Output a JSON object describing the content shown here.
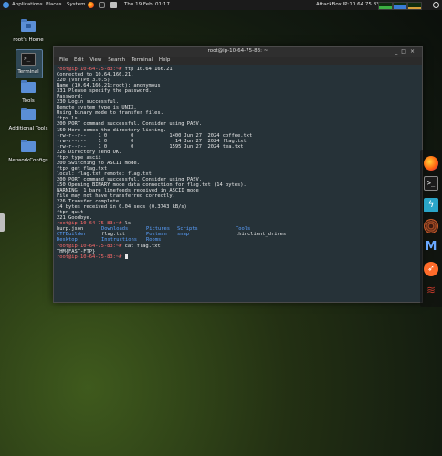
{
  "topbar": {
    "applications": "Applications",
    "places": "Places",
    "system": "System",
    "datetime": "Thu 19 Feb, 01:17",
    "ip": "AttackBox IP:10.64.75.83"
  },
  "desktop_icons": [
    {
      "label": "root's Home",
      "icon": "home-folder-icon"
    },
    {
      "label": "Terminal",
      "icon": "terminal-icon"
    },
    {
      "label": "Tools",
      "icon": "folder-icon"
    },
    {
      "label": "Additional Tools",
      "icon": "folder-icon"
    },
    {
      "label": "NetworkConfigs",
      "icon": "folder-icon"
    }
  ],
  "terminal": {
    "title": "root@ip-10-64-75-83: ~",
    "menu": [
      "File",
      "Edit",
      "View",
      "Search",
      "Terminal",
      "Help"
    ],
    "prompt": "root@ip-10-64-75-83:~#",
    "lines": [
      " ftp 10.64.166.21",
      "Connected to 10.64.166.21.",
      "220 (vsFTPd 3.0.5)",
      "Name (10.64.166.21:root): anonymous",
      "331 Please specify the password.",
      "Password:",
      "230 Login successful.",
      "Remote system type is UNIX.",
      "Using binary mode to transfer files.",
      "ftp> ls",
      "200 PORT command successful. Consider using PASV.",
      "150 Here comes the directory listing.",
      "-rw-r--r--    1 0        0            1400 Jun 27  2024 coffee.txt",
      "-rw-r--r--    1 0        0              14 Jun 27  2024 flag.txt",
      "-rw-r--r--    1 0        0            1595 Jun 27  2024 tea.txt",
      "226 Directory send OK.",
      "ftp> type ascii",
      "200 Switching to ASCII mode.",
      "ftp> get flag.txt",
      "local: flag.txt remote: flag.txt",
      "200 PORT command successful. Consider using PASV.",
      "150 Opening BINARY mode data connection for flag.txt (14 bytes).",
      "WARNING! 1 bare linefeeds received in ASCII mode",
      "File may not have transferred correctly.",
      "226 Transfer complete.",
      "14 bytes received in 0.04 secs (0.3743 kB/s)",
      "ftp> quit",
      "221 Goodbye."
    ],
    "cmd_ls": " ls",
    "ls_rows": [
      [
        {
          "text": "burp.json",
          "dir": false
        },
        {
          "text": "Downloads",
          "dir": true
        },
        {
          "text": "Pictures",
          "dir": true
        },
        {
          "text": "Scripts",
          "dir": true
        },
        {
          "text": "Tools",
          "dir": true
        }
      ],
      [
        {
          "text": "CTFBuilder",
          "dir": true
        },
        {
          "text": "flag.txt",
          "dir": false
        },
        {
          "text": "Postman",
          "dir": true
        },
        {
          "text": "snap",
          "dir": true
        },
        {
          "text": "thinclient_drives",
          "dir": false
        }
      ],
      [
        {
          "text": "Desktop",
          "dir": true
        },
        {
          "text": "Instructions",
          "dir": true
        },
        {
          "text": "Rooms",
          "dir": true
        },
        {
          "text": "",
          "dir": false
        },
        {
          "text": "",
          "dir": false
        }
      ]
    ],
    "cmd_cat": " cat flag.txt",
    "flag_output": "THM{FAST-FTP}"
  },
  "colors": {
    "prompt": "#ff6a6a",
    "directory": "#5aa0ff",
    "terminal_bg": "#263238"
  },
  "dock_icons": [
    "firefox-icon",
    "terminal-icon",
    "bolt-icon",
    "spiral-icon",
    "metasploit-icon",
    "compass-icon",
    "dragon-icon"
  ]
}
